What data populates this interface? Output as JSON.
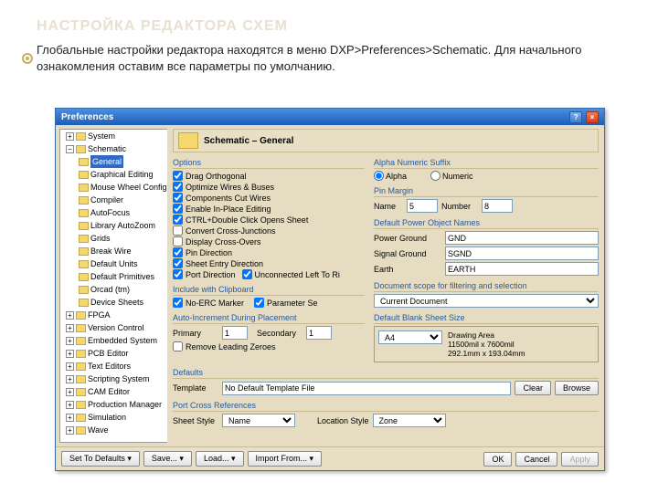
{
  "slide": {
    "title": "НАСТРОЙКА РЕДАКТОРА СХЕМ",
    "body": "Глобальные настройки редактора находятся в меню DXP>Preferences>Schematic. Для начального ознакомления оставим все параметры по умолчанию."
  },
  "window": {
    "title": "Preferences",
    "crumb": "Schematic – General"
  },
  "tree": {
    "system": "System",
    "schematic": "Schematic",
    "items": [
      {
        "label": "General",
        "sel": true
      },
      {
        "label": "Graphical Editing"
      },
      {
        "label": "Mouse Wheel Configuration"
      },
      {
        "label": "Compiler"
      },
      {
        "label": "AutoFocus"
      },
      {
        "label": "Library AutoZoom"
      },
      {
        "label": "Grids"
      },
      {
        "label": "Break Wire"
      },
      {
        "label": "Default Units"
      },
      {
        "label": "Default Primitives"
      },
      {
        "label": "Orcad (tm)"
      },
      {
        "label": "Device Sheets"
      }
    ],
    "rest": [
      "FPGA",
      "Version Control",
      "Embedded System",
      "PCB Editor",
      "Text Editors",
      "Scripting System",
      "CAM Editor",
      "Production Manager",
      "Simulation",
      "Wave"
    ]
  },
  "options": {
    "title": "Options",
    "drag_orthogonal": "Drag Orthogonal",
    "optimize": "Optimize Wires & Buses",
    "cut_wires": "Components Cut Wires",
    "inplace": "Enable In-Place Editing",
    "dblclick": "CTRL+Double Click Opens Sheet",
    "convert": "Convert Cross-Junctions",
    "display_cross": "Display Cross-Overs",
    "pin_dir": "Pin Direction",
    "sheet_entry": "Sheet Entry Direction",
    "port_dir": "Port Direction",
    "unconnected": "Unconnected Left To Ri"
  },
  "clipboard": {
    "title": "Include with Clipboard",
    "noerc": "No-ERC Marker",
    "param": "Parameter Se"
  },
  "autoinc": {
    "title": "Auto-Increment During Placement",
    "primary_label": "Primary",
    "primary": "1",
    "secondary_label": "Secondary",
    "secondary": "1",
    "remove_zeros": "Remove Leading Zeroes"
  },
  "defaults": {
    "title": "Defaults",
    "template_label": "Template",
    "template": "No Default Template File",
    "clear": "Clear",
    "browse": "Browse"
  },
  "cross_ref": {
    "title": "Port Cross References",
    "sheet_style_label": "Sheet Style",
    "sheet_style": "Name",
    "location_style_label": "Location Style",
    "location_style": "Zone"
  },
  "alpha": {
    "title": "Alpha Numeric Suffix",
    "alpha": "Alpha",
    "numeric": "Numeric"
  },
  "pin_margin": {
    "title": "Pin Margin",
    "name_label": "Name",
    "name": "5",
    "number_label": "Number",
    "number": "8"
  },
  "power": {
    "title": "Default Power Object Names",
    "pg_label": "Power Ground",
    "pg": "GND",
    "sg_label": "Signal Ground",
    "sg": "SGND",
    "earth_label": "Earth",
    "earth": "EARTH"
  },
  "scope": {
    "title": "Document scope for filtering and selection",
    "value": "Current Document"
  },
  "sheet": {
    "title": "Default Blank Sheet Size",
    "value": "A4",
    "area_title": "Drawing Area",
    "area1": "11500mil x 7600mil",
    "area2": "292.1mm x 193.04mm"
  },
  "footer": {
    "set_defaults": "Set To Defaults",
    "save": "Save...",
    "load": "Load...",
    "import": "Import From...",
    "ok": "OK",
    "cancel": "Cancel",
    "apply": "Apply"
  }
}
